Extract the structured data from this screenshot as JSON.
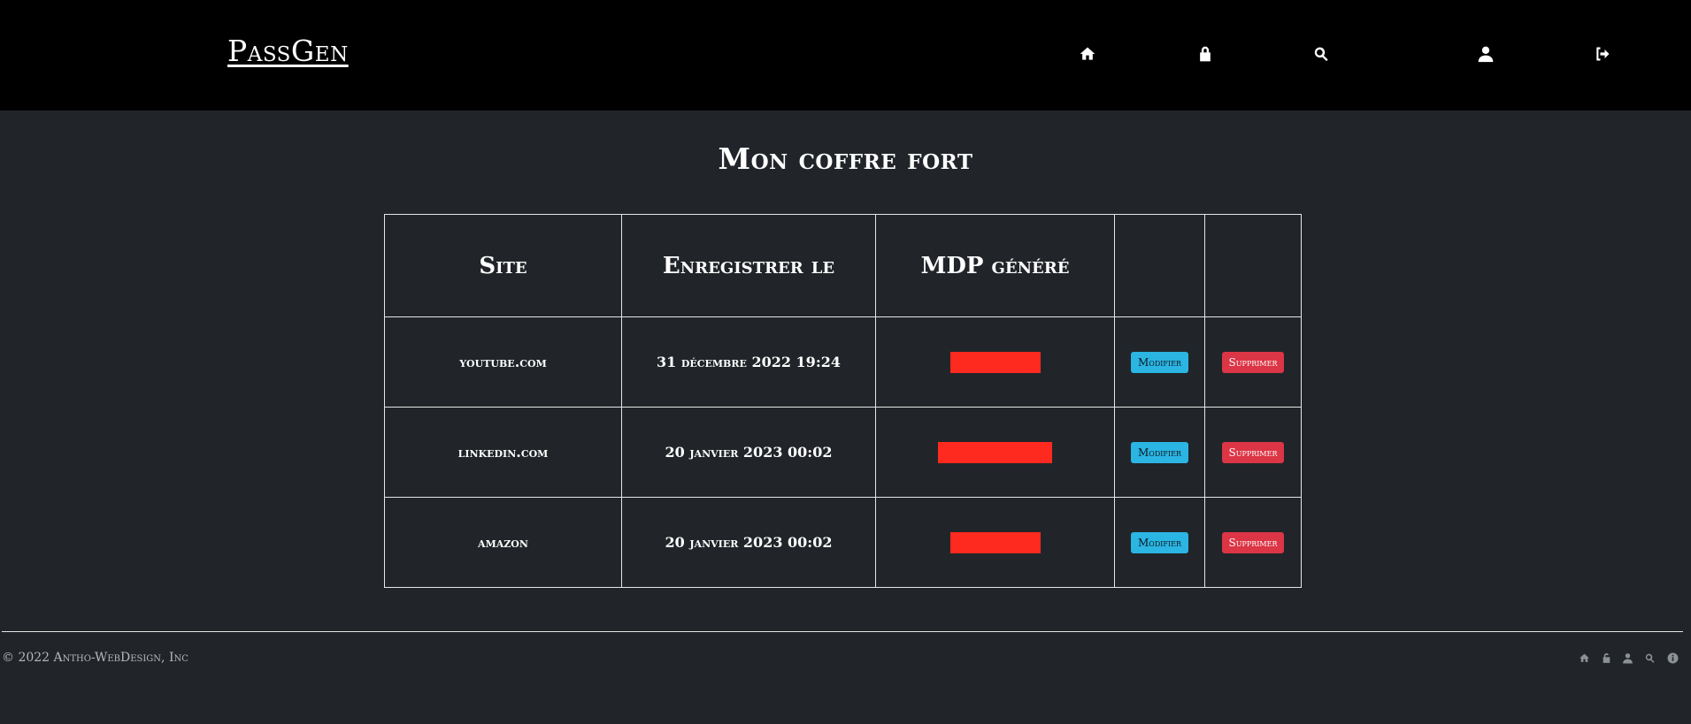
{
  "header": {
    "brand": "PassGen",
    "nav_icons": [
      "home-icon",
      "lock-icon",
      "search-icon",
      "user-icon",
      "sign-out-icon"
    ]
  },
  "page": {
    "title": "Mon coffre fort"
  },
  "table": {
    "headers": [
      "Site",
      "Enregistrer le",
      "MDP généré",
      "",
      ""
    ],
    "rows": [
      {
        "site": "youtube.com",
        "date": "31 décembre 2022 19:24",
        "modify_label": "Modifier",
        "delete_label": "Supprimer"
      },
      {
        "site": "linkedin.com",
        "date": "20 janvier 2023 00:02",
        "modify_label": "Modifier",
        "delete_label": "Supprimer"
      },
      {
        "site": "amazon",
        "date": "20 janvier 2023 00:02",
        "modify_label": "Modifier",
        "delete_label": "Supprimer"
      }
    ]
  },
  "footer": {
    "copyright": "© 2022 Antho-WebDesign, Inc",
    "icons": [
      "home-icon",
      "unlock-icon",
      "user-icon",
      "search-icon",
      "info-icon"
    ]
  },
  "colors": {
    "header_bg": "#000000",
    "page_bg": "#212529",
    "redaction": "#ff2a1f",
    "modify_button": "#2bb5e3",
    "delete_button": "#dc3545"
  }
}
